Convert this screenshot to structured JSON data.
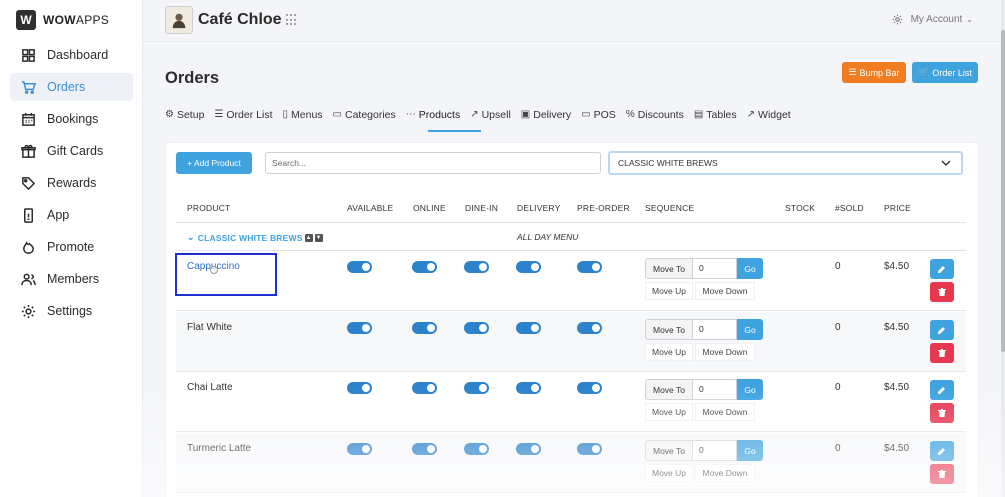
{
  "app": {
    "logo_mark": "W",
    "logo_text_bold": "WOW",
    "logo_text_rest": "APPS"
  },
  "sidebar": {
    "items": [
      {
        "label": "Dashboard",
        "icon": "dashboard-icon"
      },
      {
        "label": "Orders",
        "icon": "cart-icon",
        "active": true
      },
      {
        "label": "Bookings",
        "icon": "calendar-icon"
      },
      {
        "label": "Gift Cards",
        "icon": "gift-icon"
      },
      {
        "label": "Rewards",
        "icon": "tag-icon"
      },
      {
        "label": "App",
        "icon": "mobile-icon"
      },
      {
        "label": "Promote",
        "icon": "rocket-icon"
      },
      {
        "label": "Members",
        "icon": "users-icon"
      },
      {
        "label": "Settings",
        "icon": "gear-icon"
      }
    ]
  },
  "header": {
    "store_name": "Café Chloe",
    "account_label": "My Account"
  },
  "page": {
    "title": "Orders",
    "bump_bar_label": "Bump Bar",
    "order_list_label": "Order List"
  },
  "tabs": [
    {
      "label": "Setup",
      "icon": "⚙"
    },
    {
      "label": "Order List",
      "icon": "☰"
    },
    {
      "label": "Menus",
      "icon": "▯"
    },
    {
      "label": "Categories",
      "icon": "▭"
    },
    {
      "label": "Products",
      "icon": "⋯",
      "active": true
    },
    {
      "label": "Upsell",
      "icon": "↗"
    },
    {
      "label": "Delivery",
      "icon": "▣"
    },
    {
      "label": "POS",
      "icon": "▭"
    },
    {
      "label": "Discounts",
      "icon": "%"
    },
    {
      "label": "Tables",
      "icon": "▤"
    },
    {
      "label": "Widget",
      "icon": "↗"
    }
  ],
  "toolbar": {
    "add_product_label": "+ Add Product",
    "search_placeholder": "Search...",
    "category_selected": "CLASSIC WHITE BREWS"
  },
  "table": {
    "headers": {
      "product": "PRODUCT",
      "available": "AVAILABLE",
      "online": "ONLINE",
      "dine_in": "DINE-IN",
      "delivery": "DELIVERY",
      "pre_order": "PRE-ORDER",
      "sequence": "SEQUENCE",
      "stock": "STOCK",
      "sold": "#SOLD",
      "price": "PRICE"
    },
    "group_label": "CLASSIC WHITE BREWS",
    "group_menu": "ALL DAY MENU",
    "move_to_label": "Move To",
    "go_label": "Go",
    "move_up_label": "Move Up",
    "move_down_label": "Move Down",
    "rows": [
      {
        "name": "Cappuccino",
        "seq_value": "0",
        "sold": "0",
        "price": "$4.50"
      },
      {
        "name": "Flat White",
        "seq_value": "0",
        "sold": "0",
        "price": "$4.50"
      },
      {
        "name": "Chai Latte",
        "seq_value": "0",
        "sold": "0",
        "price": "$4.50"
      },
      {
        "name": "Turmeric Latte",
        "seq_value": "0",
        "sold": "0",
        "price": "$4.50"
      }
    ]
  },
  "colors": {
    "accent": "#3fa3e0",
    "toggle_on": "#2d82cc",
    "bump_bar": "#f17d23",
    "delete": "#e63950",
    "highlight_box": "#1f2fd0"
  }
}
